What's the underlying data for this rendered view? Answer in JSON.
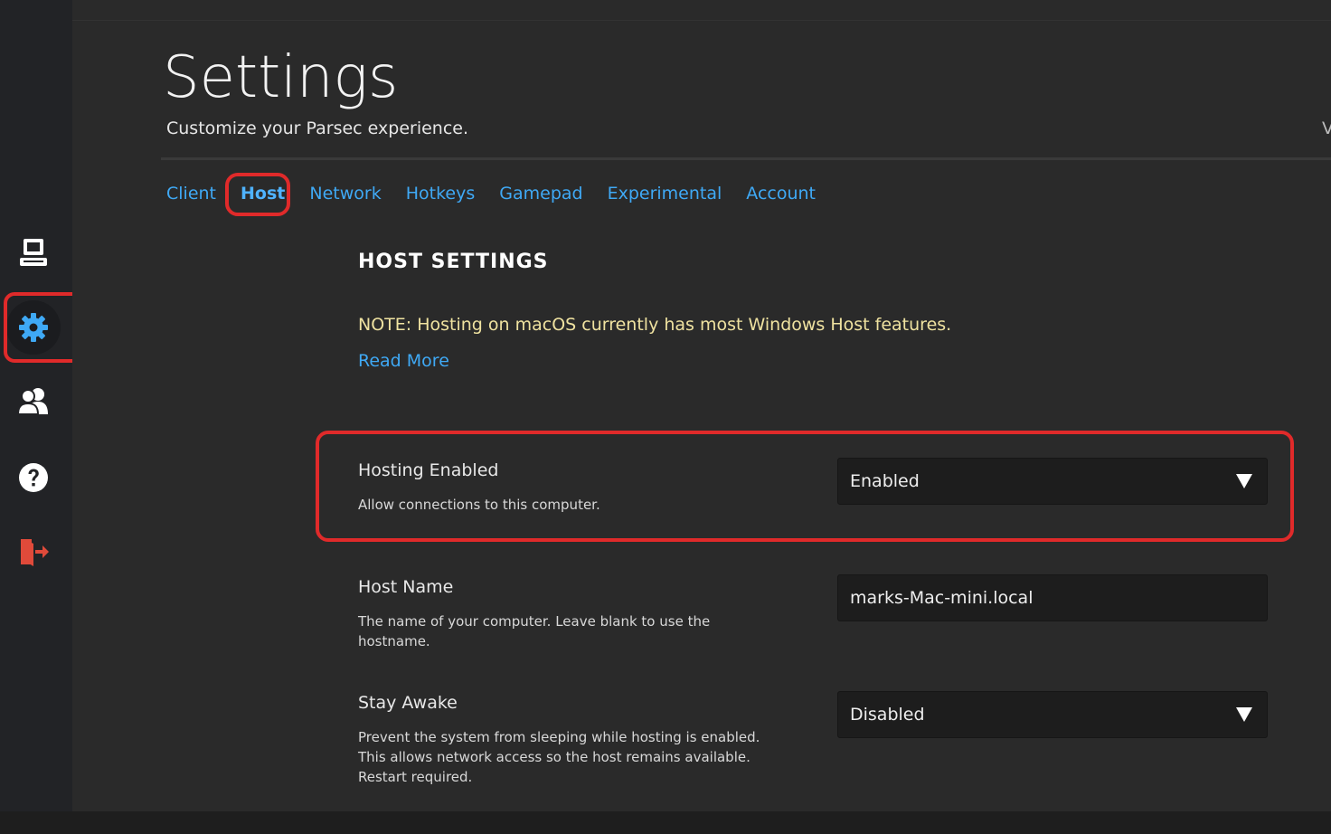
{
  "sidebar": {
    "items": [
      {
        "name": "computers",
        "icon": "computer-icon"
      },
      {
        "name": "settings",
        "icon": "gear-icon",
        "active": true
      },
      {
        "name": "friends",
        "icon": "users-icon"
      },
      {
        "name": "help",
        "icon": "help-icon"
      },
      {
        "name": "logout",
        "icon": "logout-icon"
      }
    ]
  },
  "header": {
    "title": "Settings",
    "subtitle": "Customize your Parsec experience.",
    "cut_text": "V"
  },
  "tabs": [
    {
      "label": "Client"
    },
    {
      "label": "Host",
      "active": true
    },
    {
      "label": "Network"
    },
    {
      "label": "Hotkeys"
    },
    {
      "label": "Gamepad"
    },
    {
      "label": "Experimental"
    },
    {
      "label": "Account"
    }
  ],
  "host": {
    "section_title": "HOST SETTINGS",
    "note": "NOTE: Hosting on macOS currently has most Windows Host features.",
    "read_more": "Read More",
    "hosting_enabled": {
      "label": "Hosting Enabled",
      "description": "Allow connections to this computer.",
      "value": "Enabled"
    },
    "host_name": {
      "label": "Host Name",
      "description": "The name of your computer. Leave blank to use the hostname.",
      "value": "marks-Mac-mini.local"
    },
    "stay_awake": {
      "label": "Stay Awake",
      "description": "Prevent the system from sleeping while hosting is enabled. This allows network access so the host remains available. Restart required.",
      "value": "Disabled"
    }
  },
  "colors": {
    "accent": "#3fa9f5",
    "note": "#efe2a0",
    "highlight": "#e02a2a",
    "logout": "#e04a3a"
  }
}
